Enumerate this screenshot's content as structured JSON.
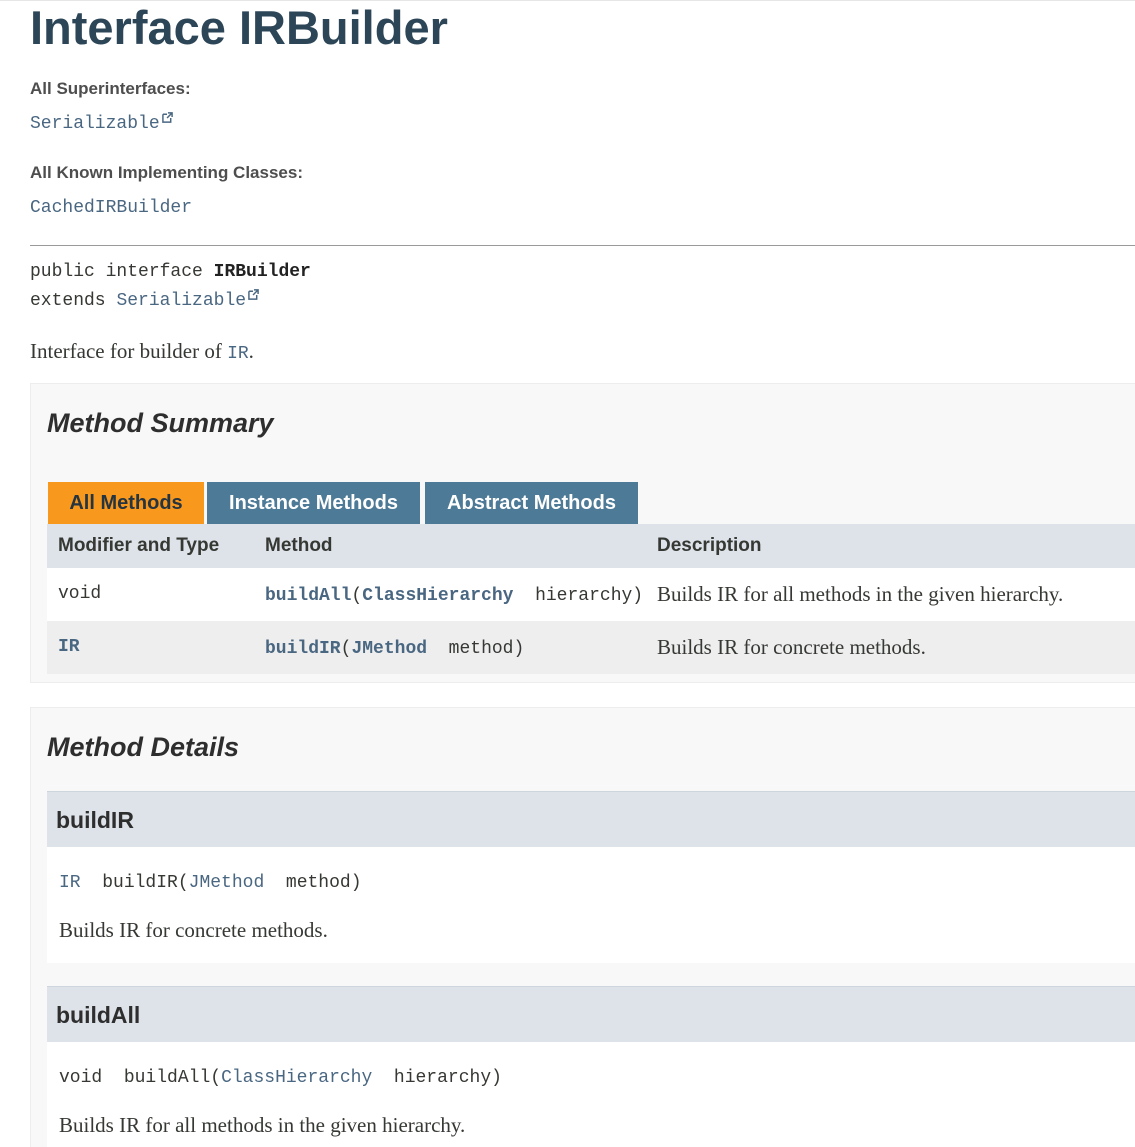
{
  "header": {
    "title": "Interface IRBuilder"
  },
  "superinterfaces": {
    "label": "All Superinterfaces:",
    "items": [
      "Serializable"
    ]
  },
  "implementing_classes": {
    "label": "All Known Implementing Classes:",
    "items": [
      "CachedIRBuilder"
    ]
  },
  "declaration": {
    "modifiers": "public interface",
    "name": "IRBuilder",
    "extends_keyword": "extends",
    "extends_type": "Serializable"
  },
  "description": {
    "text": "Interface for builder of",
    "link": "IR",
    "period": "."
  },
  "method_summary": {
    "title": "Method Summary",
    "tabs": [
      "All Methods",
      "Instance Methods",
      "Abstract Methods"
    ],
    "active_tab": "All Methods",
    "columns": [
      "Modifier and Type",
      "Method",
      "Description"
    ],
    "rows": [
      {
        "type": "void",
        "method_name": "buildAll",
        "param_type": "ClassHierarchy",
        "param_name": "hierarchy",
        "description": "Builds IR for all methods in the given hierarchy."
      },
      {
        "type": "IR",
        "method_name": "buildIR",
        "param_type": "JMethod",
        "param_name": "method",
        "description": "Builds IR for concrete methods."
      }
    ]
  },
  "method_details": {
    "title": "Method Details",
    "methods": [
      {
        "name": "buildIR",
        "return_type": "IR",
        "param_type": "JMethod",
        "param_name": "method",
        "description": "Builds IR for concrete methods."
      },
      {
        "name": "buildAll",
        "return_type": "void",
        "param_type": "ClassHierarchy",
        "param_name": "hierarchy",
        "description": "Builds IR for all methods in the given hierarchy."
      }
    ]
  },
  "colors": {
    "title": "#2c4557",
    "link": "#4a6782",
    "tab_active": "#f8981d",
    "tab_inactive": "#4d7a97",
    "table_header": "#dee3e9"
  },
  "icons": [
    "external-link-icon"
  ]
}
